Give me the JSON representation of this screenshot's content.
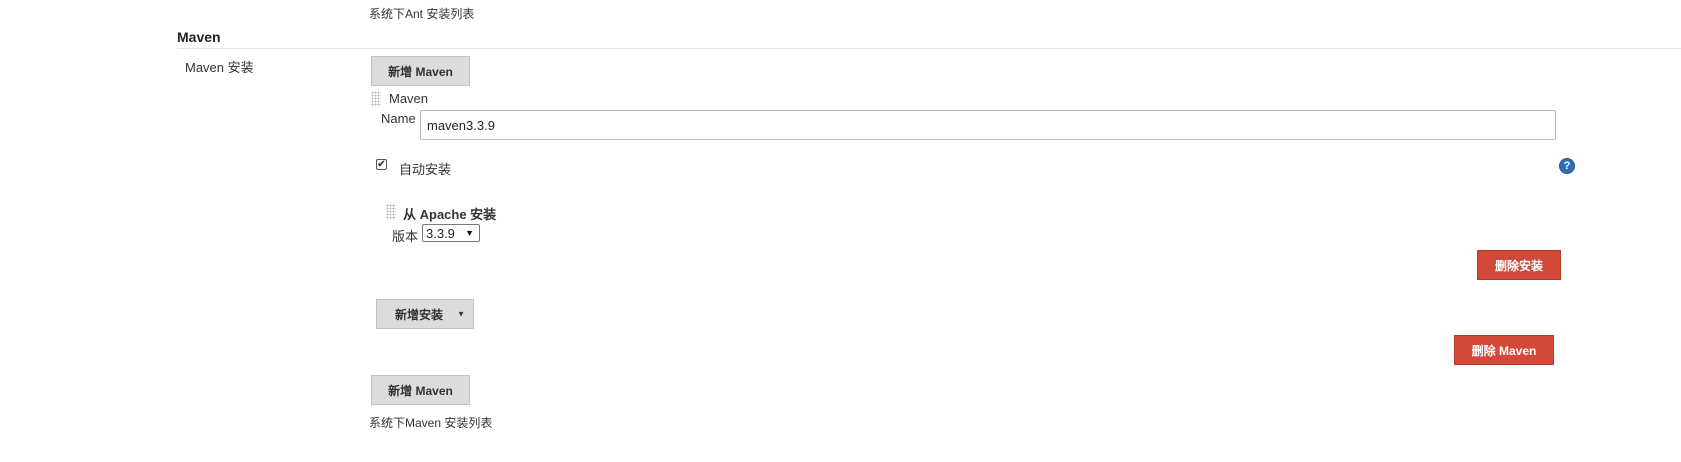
{
  "ant": {
    "list_desc": "系统下Ant 安装列表"
  },
  "maven_section": {
    "title": "Maven",
    "row_label": "Maven 安装",
    "add_maven_top_label": "新增 Maven",
    "install_item": {
      "header": "Maven",
      "name_label": "Name",
      "name_value": "maven3.3.9",
      "auto_install_label": "自动安装",
      "auto_install_checked": true,
      "installer": {
        "header": "从 Apache 安装",
        "version_label": "版本",
        "version_value": "3.3.9"
      },
      "delete_installer_label": "删除安装",
      "add_installer_label": "新增安装",
      "delete_maven_label": "删除 Maven"
    },
    "add_maven_bottom_label": "新增 Maven",
    "list_desc": "系统下Maven 安装列表"
  },
  "icons": {
    "help": "help-icon",
    "drag_handle": "drag-handle-icon",
    "dropdown": "caret-down-icon",
    "check": "check-icon"
  },
  "colors": {
    "danger_button": "#d24939",
    "neutral_button": "#dcdcdc",
    "help_icon": "#2f6fb5"
  }
}
